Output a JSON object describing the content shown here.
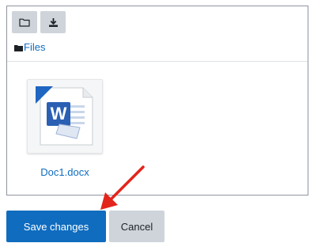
{
  "file_manager": {
    "toolbar": {
      "new_folder_icon": "folder-outline-icon",
      "download_icon": "download-icon"
    },
    "path": {
      "icon": "folder-filled-icon",
      "label": "Files"
    },
    "files": [
      {
        "name": "Doc1.docx",
        "icon": "word-document-icon"
      }
    ]
  },
  "actions": {
    "save_label": "Save changes",
    "cancel_label": "Cancel"
  },
  "colors": {
    "primary": "#0f6cbf",
    "secondary_button": "#ced4da",
    "annotation_arrow": "#e3241b",
    "link": "#0f6cbf"
  }
}
